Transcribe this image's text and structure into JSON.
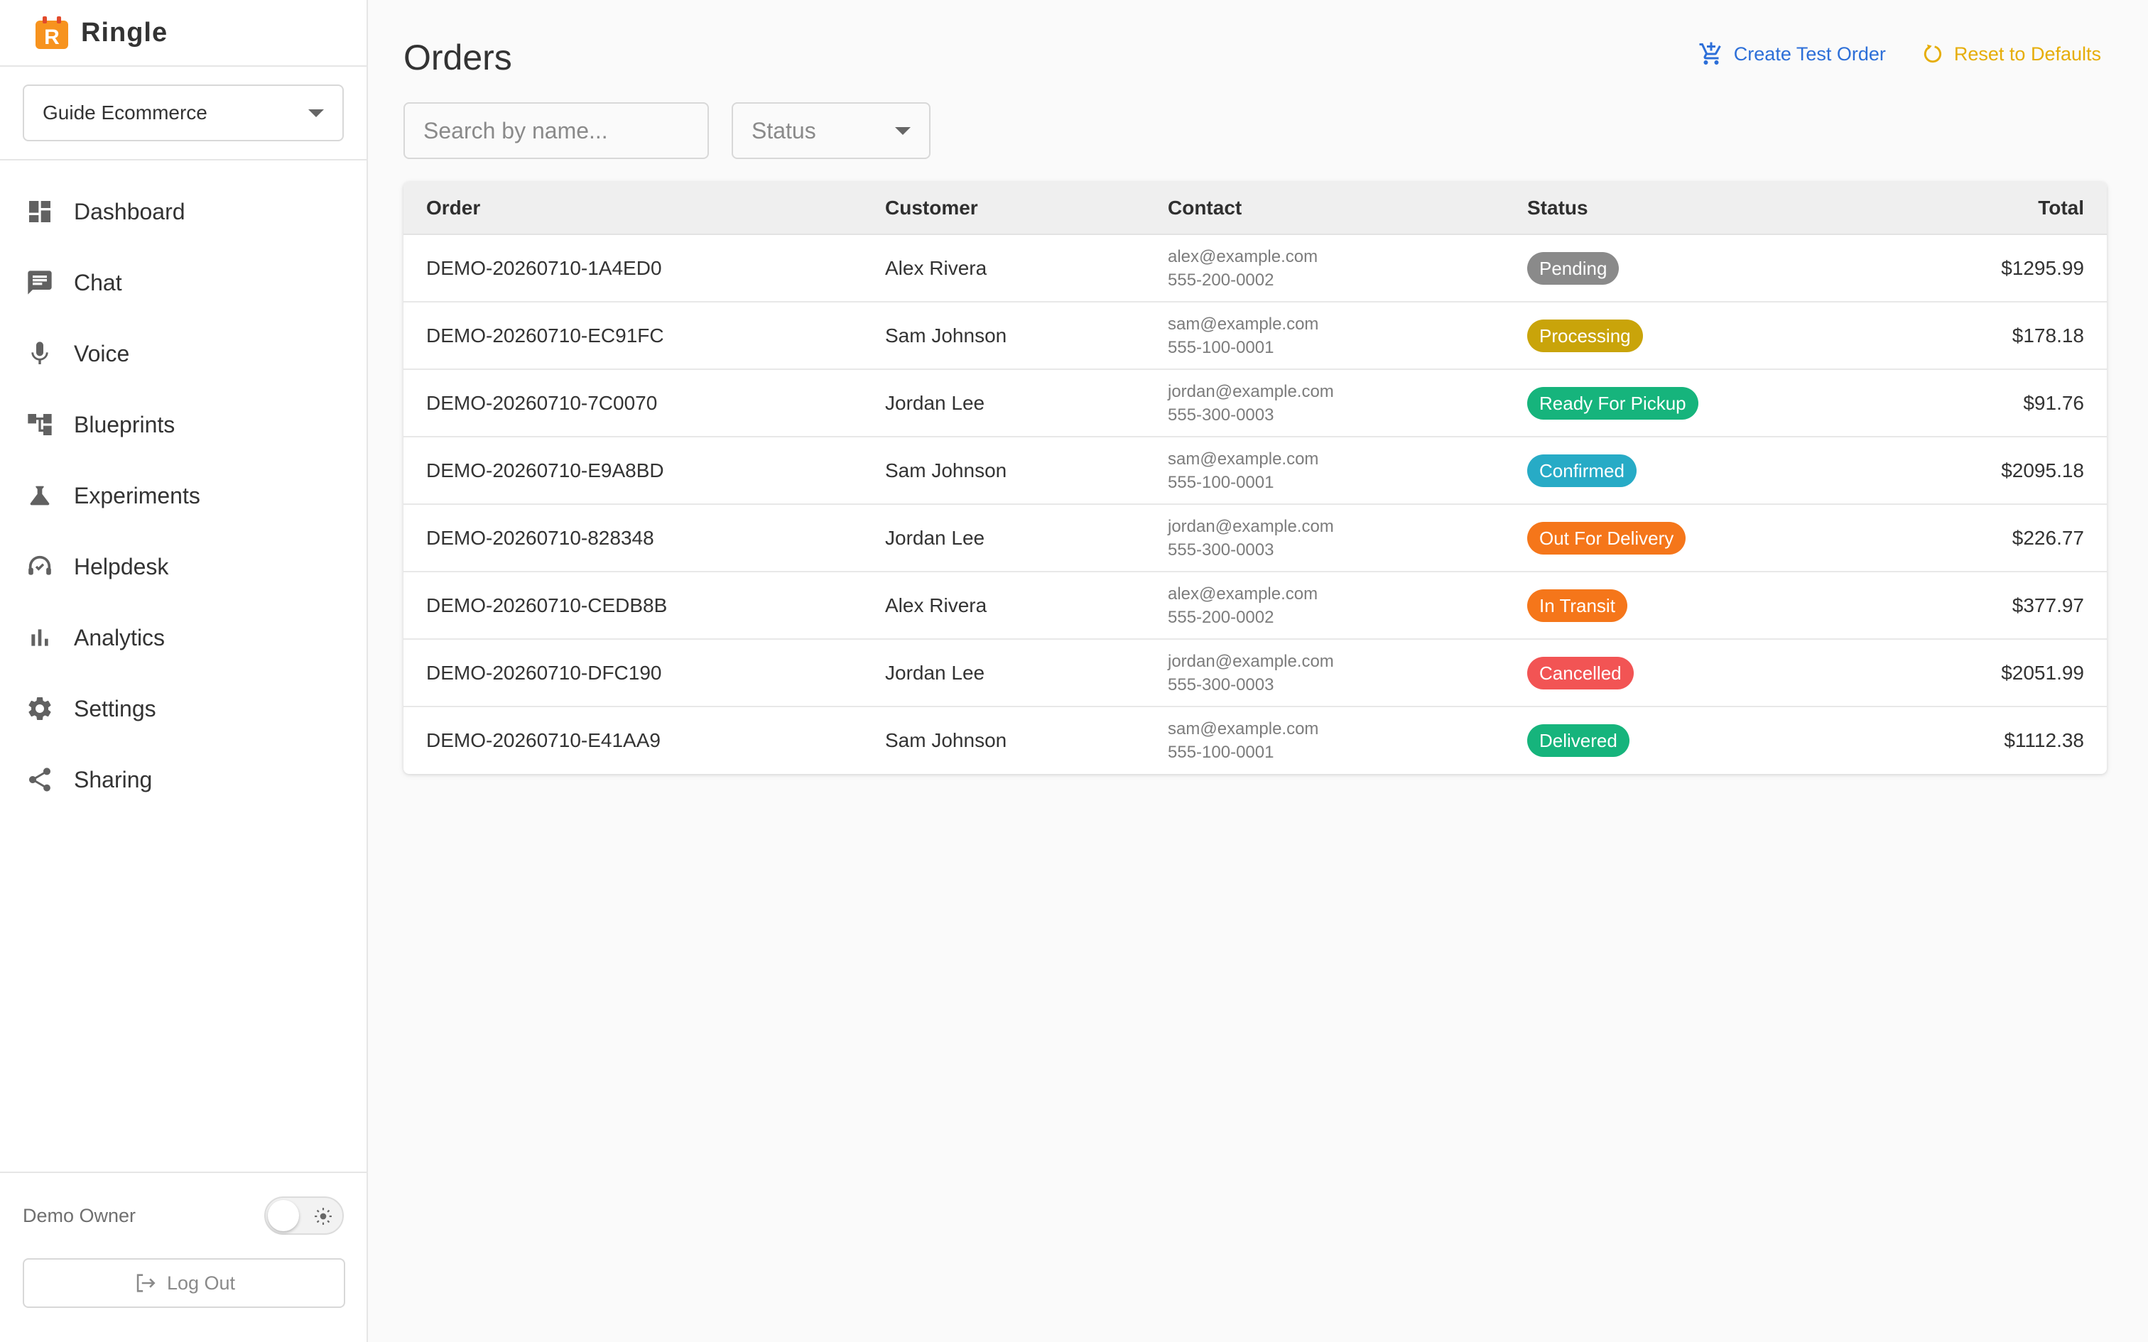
{
  "brand": {
    "name": "Ringle",
    "logo_letter": "R"
  },
  "workspace": {
    "selected": "Guide Ecommerce"
  },
  "nav": {
    "items": [
      {
        "label": "Dashboard",
        "icon": "dashboard-icon"
      },
      {
        "label": "Chat",
        "icon": "chat-icon"
      },
      {
        "label": "Voice",
        "icon": "microphone-icon"
      },
      {
        "label": "Blueprints",
        "icon": "blueprint-icon"
      },
      {
        "label": "Experiments",
        "icon": "flask-icon"
      },
      {
        "label": "Helpdesk",
        "icon": "headset-icon"
      },
      {
        "label": "Analytics",
        "icon": "bar-chart-icon"
      },
      {
        "label": "Settings",
        "icon": "gear-icon"
      },
      {
        "label": "Sharing",
        "icon": "share-icon"
      }
    ]
  },
  "footer": {
    "owner": "Demo Owner",
    "logout_label": "Log Out",
    "theme_icon": "sun-icon"
  },
  "page": {
    "title": "Orders",
    "actions": {
      "create_label": "Create Test Order",
      "reset_label": "Reset to Defaults"
    },
    "search": {
      "placeholder": "Search by name..."
    },
    "status_filter": {
      "label": "Status"
    }
  },
  "colors": {
    "accent_blue": "#2d6fd8",
    "accent_amber": "#e6ad07",
    "brand_orange": "#f7931e",
    "status": {
      "Pending": "#8a8a8a",
      "Processing": "#c9a40a",
      "Ready For Pickup": "#16b47c",
      "Confirmed": "#27abc6",
      "Out For Delivery": "#f5761a",
      "In Transit": "#f5761a",
      "Cancelled": "#f25454",
      "Delivered": "#16b47c"
    }
  },
  "table": {
    "headers": {
      "order": "Order",
      "customer": "Customer",
      "contact": "Contact",
      "status": "Status",
      "total": "Total"
    },
    "rows": [
      {
        "order": "DEMO-20260710-1A4ED0",
        "customer": "Alex Rivera",
        "email": "alex@example.com",
        "phone": "555-200-0002",
        "status": "Pending",
        "total": "$1295.99"
      },
      {
        "order": "DEMO-20260710-EC91FC",
        "customer": "Sam Johnson",
        "email": "sam@example.com",
        "phone": "555-100-0001",
        "status": "Processing",
        "total": "$178.18"
      },
      {
        "order": "DEMO-20260710-7C0070",
        "customer": "Jordan Lee",
        "email": "jordan@example.com",
        "phone": "555-300-0003",
        "status": "Ready For Pickup",
        "total": "$91.76"
      },
      {
        "order": "DEMO-20260710-E9A8BD",
        "customer": "Sam Johnson",
        "email": "sam@example.com",
        "phone": "555-100-0001",
        "status": "Confirmed",
        "total": "$2095.18"
      },
      {
        "order": "DEMO-20260710-828348",
        "customer": "Jordan Lee",
        "email": "jordan@example.com",
        "phone": "555-300-0003",
        "status": "Out For Delivery",
        "total": "$226.77"
      },
      {
        "order": "DEMO-20260710-CEDB8B",
        "customer": "Alex Rivera",
        "email": "alex@example.com",
        "phone": "555-200-0002",
        "status": "In Transit",
        "total": "$377.97"
      },
      {
        "order": "DEMO-20260710-DFC190",
        "customer": "Jordan Lee",
        "email": "jordan@example.com",
        "phone": "555-300-0003",
        "status": "Cancelled",
        "total": "$2051.99"
      },
      {
        "order": "DEMO-20260710-E41AA9",
        "customer": "Sam Johnson",
        "email": "sam@example.com",
        "phone": "555-100-0001",
        "status": "Delivered",
        "total": "$1112.38"
      }
    ]
  }
}
